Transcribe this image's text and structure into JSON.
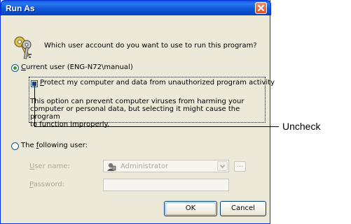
{
  "window": {
    "title": "Run As"
  },
  "prompt": {
    "question": "Which user account do you want to use to run this program?"
  },
  "current_user": {
    "label_accel": "C",
    "label_rest": "urrent user (ENG-N72\\manual)",
    "selected": true
  },
  "protect": {
    "label_accel": "P",
    "label_rest": "rotect my computer and data from unauthorized program activity",
    "description_line1": "This option can prevent computer viruses from harming your",
    "description_line2": "computer or personal data, but selecting it might cause the program",
    "description_line3": "to function improperly.",
    "checked": true
  },
  "annotation": {
    "text": "Uncheck"
  },
  "following_user": {
    "label_pre": "The ",
    "label_accel": "f",
    "label_rest": "ollowing user:",
    "selected": false
  },
  "user_name": {
    "label_accel": "U",
    "label_rest": "ser name:",
    "value": "Administrator",
    "browse_label": "..."
  },
  "password": {
    "label_accel": "P",
    "label_rest": "assword:",
    "value": ""
  },
  "buttons": {
    "ok": "OK",
    "cancel": "Cancel"
  },
  "icons": {
    "title_close": "close-icon",
    "keys": "keys-icon",
    "user_avatar": "user-icon",
    "dropdown": "chevron-down-icon"
  },
  "colors": {
    "titlebar": "#0a5ce0",
    "dialog_bg": "#ece9d8",
    "close_button": "#e14b22",
    "radio_dot": "#2aa12a",
    "disabled_text": "#aca899"
  }
}
